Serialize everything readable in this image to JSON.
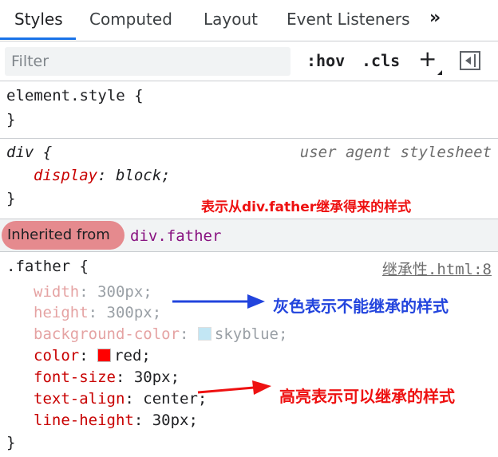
{
  "tabs": [
    {
      "label": "Styles",
      "active": true
    },
    {
      "label": "Computed",
      "active": false
    },
    {
      "label": "Layout",
      "active": false
    },
    {
      "label": "Event Listeners",
      "active": false
    }
  ],
  "tabs_overflow": "»",
  "toolbar": {
    "filter_placeholder": "Filter",
    "hov_label": ":hov",
    "cls_label": ".cls",
    "add_rule_label": "+"
  },
  "element_style": {
    "open": "element.style {",
    "close": "}"
  },
  "ua_rule": {
    "selector": "div",
    "brace_open": " {",
    "source": "user agent stylesheet",
    "property": "display",
    "value": "block",
    "close": "}"
  },
  "annotations": {
    "inherited_note": "表示从div.father继承得来的样式",
    "gray_note": "灰色表示不能继承的样式",
    "highlight_note": "高亮表示可以继承的样式"
  },
  "inherited": {
    "label": "Inherited from",
    "selector": "div.father"
  },
  "father_rule": {
    "selector": ".father {",
    "source": "继承性.html:8",
    "close": "}",
    "declarations": [
      {
        "property": "width",
        "value": "300px",
        "inheritable": false
      },
      {
        "property": "height",
        "value": "300px",
        "inheritable": false
      },
      {
        "property": "background-color",
        "value": "skyblue",
        "inheritable": false,
        "swatch": "#87ceeb"
      },
      {
        "property": "color",
        "value": "red",
        "inheritable": true,
        "swatch": "#ff0000"
      },
      {
        "property": "font-size",
        "value": "30px",
        "inheritable": true
      },
      {
        "property": "text-align",
        "value": "center",
        "inheritable": true
      },
      {
        "property": "line-height",
        "value": "30px",
        "inheritable": true
      }
    ]
  },
  "colors": {
    "accent": "#1a73e8",
    "annotation_red": "#ee1111",
    "annotation_blue": "#2244dd",
    "pill": "#e58a8e"
  }
}
